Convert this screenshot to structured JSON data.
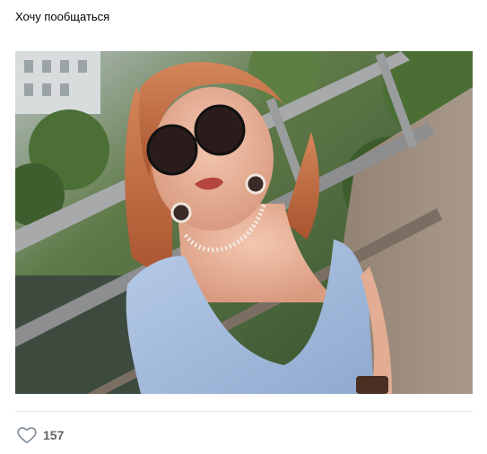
{
  "post": {
    "text": "Хочу пообщаться"
  },
  "likes": {
    "count": "157",
    "icon": "heart-outline-icon"
  },
  "colors": {
    "divider": "#e7e8ec",
    "like_count": "#656565",
    "like_icon": "#818c99"
  }
}
